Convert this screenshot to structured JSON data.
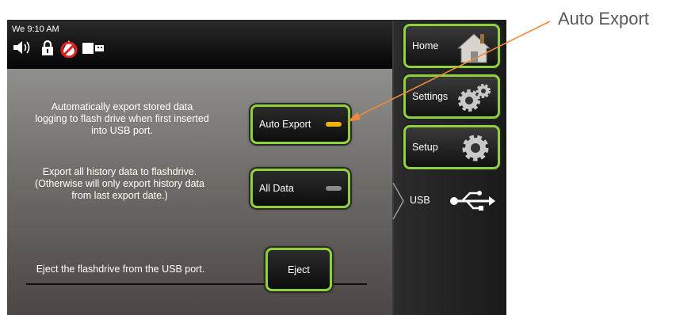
{
  "status": {
    "time": "We 9:10 AM"
  },
  "auto_export": {
    "description": "Automatically export stored data logging to flash drive when first inserted into USB port.",
    "button_label": "Auto Export",
    "indicator_color": "#f0b400"
  },
  "all_data": {
    "description": "Export all history data to flashdrive. (Otherwise will only export history data from last export date.)",
    "button_label": "All Data",
    "indicator_color": "#8a8a8a"
  },
  "eject": {
    "description": "Eject the flashdrive from the USB port.",
    "button_label": "Eject"
  },
  "sidebar": {
    "home_label": "Home",
    "settings_label": "Settings",
    "setup_label": "Setup",
    "usb_label": "USB"
  },
  "callout": {
    "label": "Auto Export",
    "arrow_color": "#f08a3c"
  },
  "colors": {
    "button_border": "#8ed13a"
  }
}
